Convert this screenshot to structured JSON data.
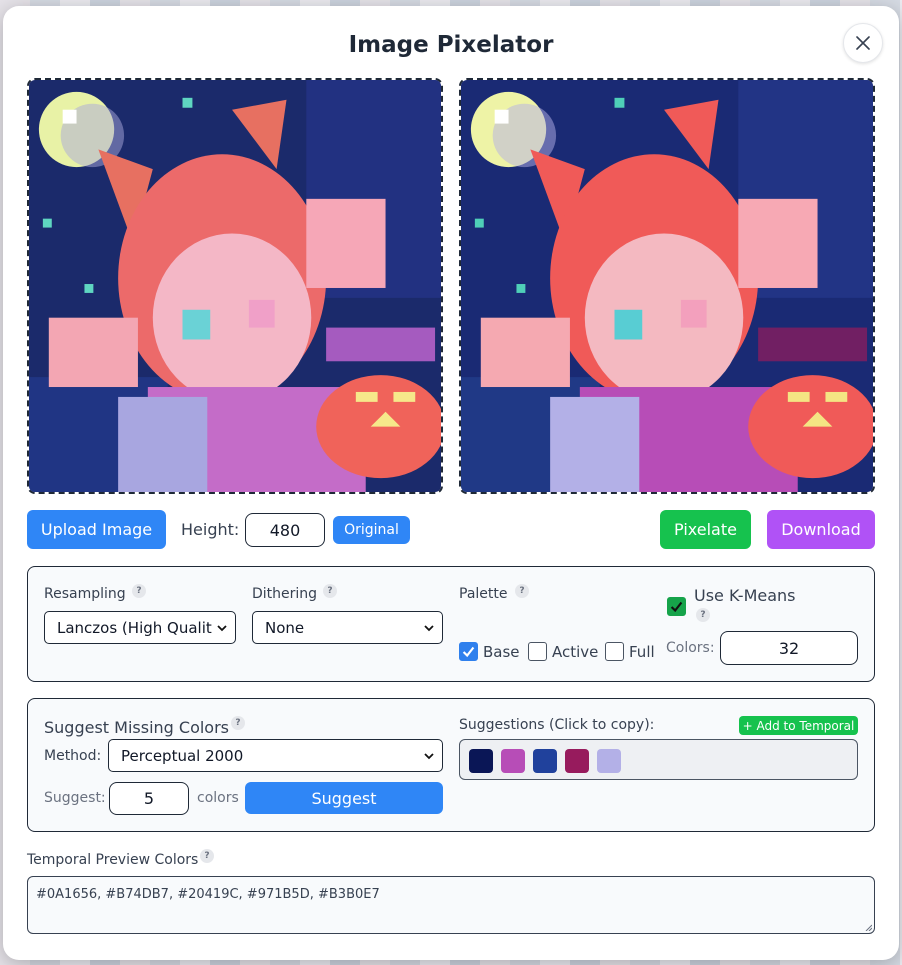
{
  "app": {
    "title": "Image Pixelator"
  },
  "toolbar": {
    "upload_label": "Upload Image",
    "height_label": "Height:",
    "height_value": "480",
    "original_label": "Original",
    "pixelate_label": "Pixelate",
    "download_label": "Download"
  },
  "settings": {
    "resampling_label": "Resampling",
    "resampling_value": "Lanczos (High Qualit",
    "dithering_label": "Dithering",
    "dithering_value": "None",
    "palette_label": "Palette",
    "palette_options": [
      {
        "label": "Base",
        "checked": true
      },
      {
        "label": "Active",
        "checked": false
      },
      {
        "label": "Full",
        "checked": false
      }
    ],
    "kmeans_label": "Use K-Means",
    "kmeans_checked": true,
    "colors_label": "Colors:",
    "colors_value": "32"
  },
  "suggest": {
    "title": "Suggest Missing Colors",
    "method_label": "Method:",
    "method_value": "Perceptual 2000",
    "suggest_label": "Suggest:",
    "suggest_count": "5",
    "colors_unit": "colors",
    "suggest_button": "Suggest",
    "suggestions_label": "Suggestions (Click to copy):",
    "add_temporal_label": "+ Add to Temporal",
    "swatches": [
      "#0A1656",
      "#B74DB7",
      "#20419C",
      "#971B5D",
      "#B3B0E7"
    ]
  },
  "temporal": {
    "label": "Temporal Preview Colors",
    "value": "#0A1656, #B74DB7, #20419C, #971B5D, #B3B0E7"
  },
  "help_glyph": "?",
  "icons": {
    "close": "close-icon",
    "help": "help-icon",
    "checkmark": "checkmark-icon",
    "select": "chevron-down-icon"
  }
}
